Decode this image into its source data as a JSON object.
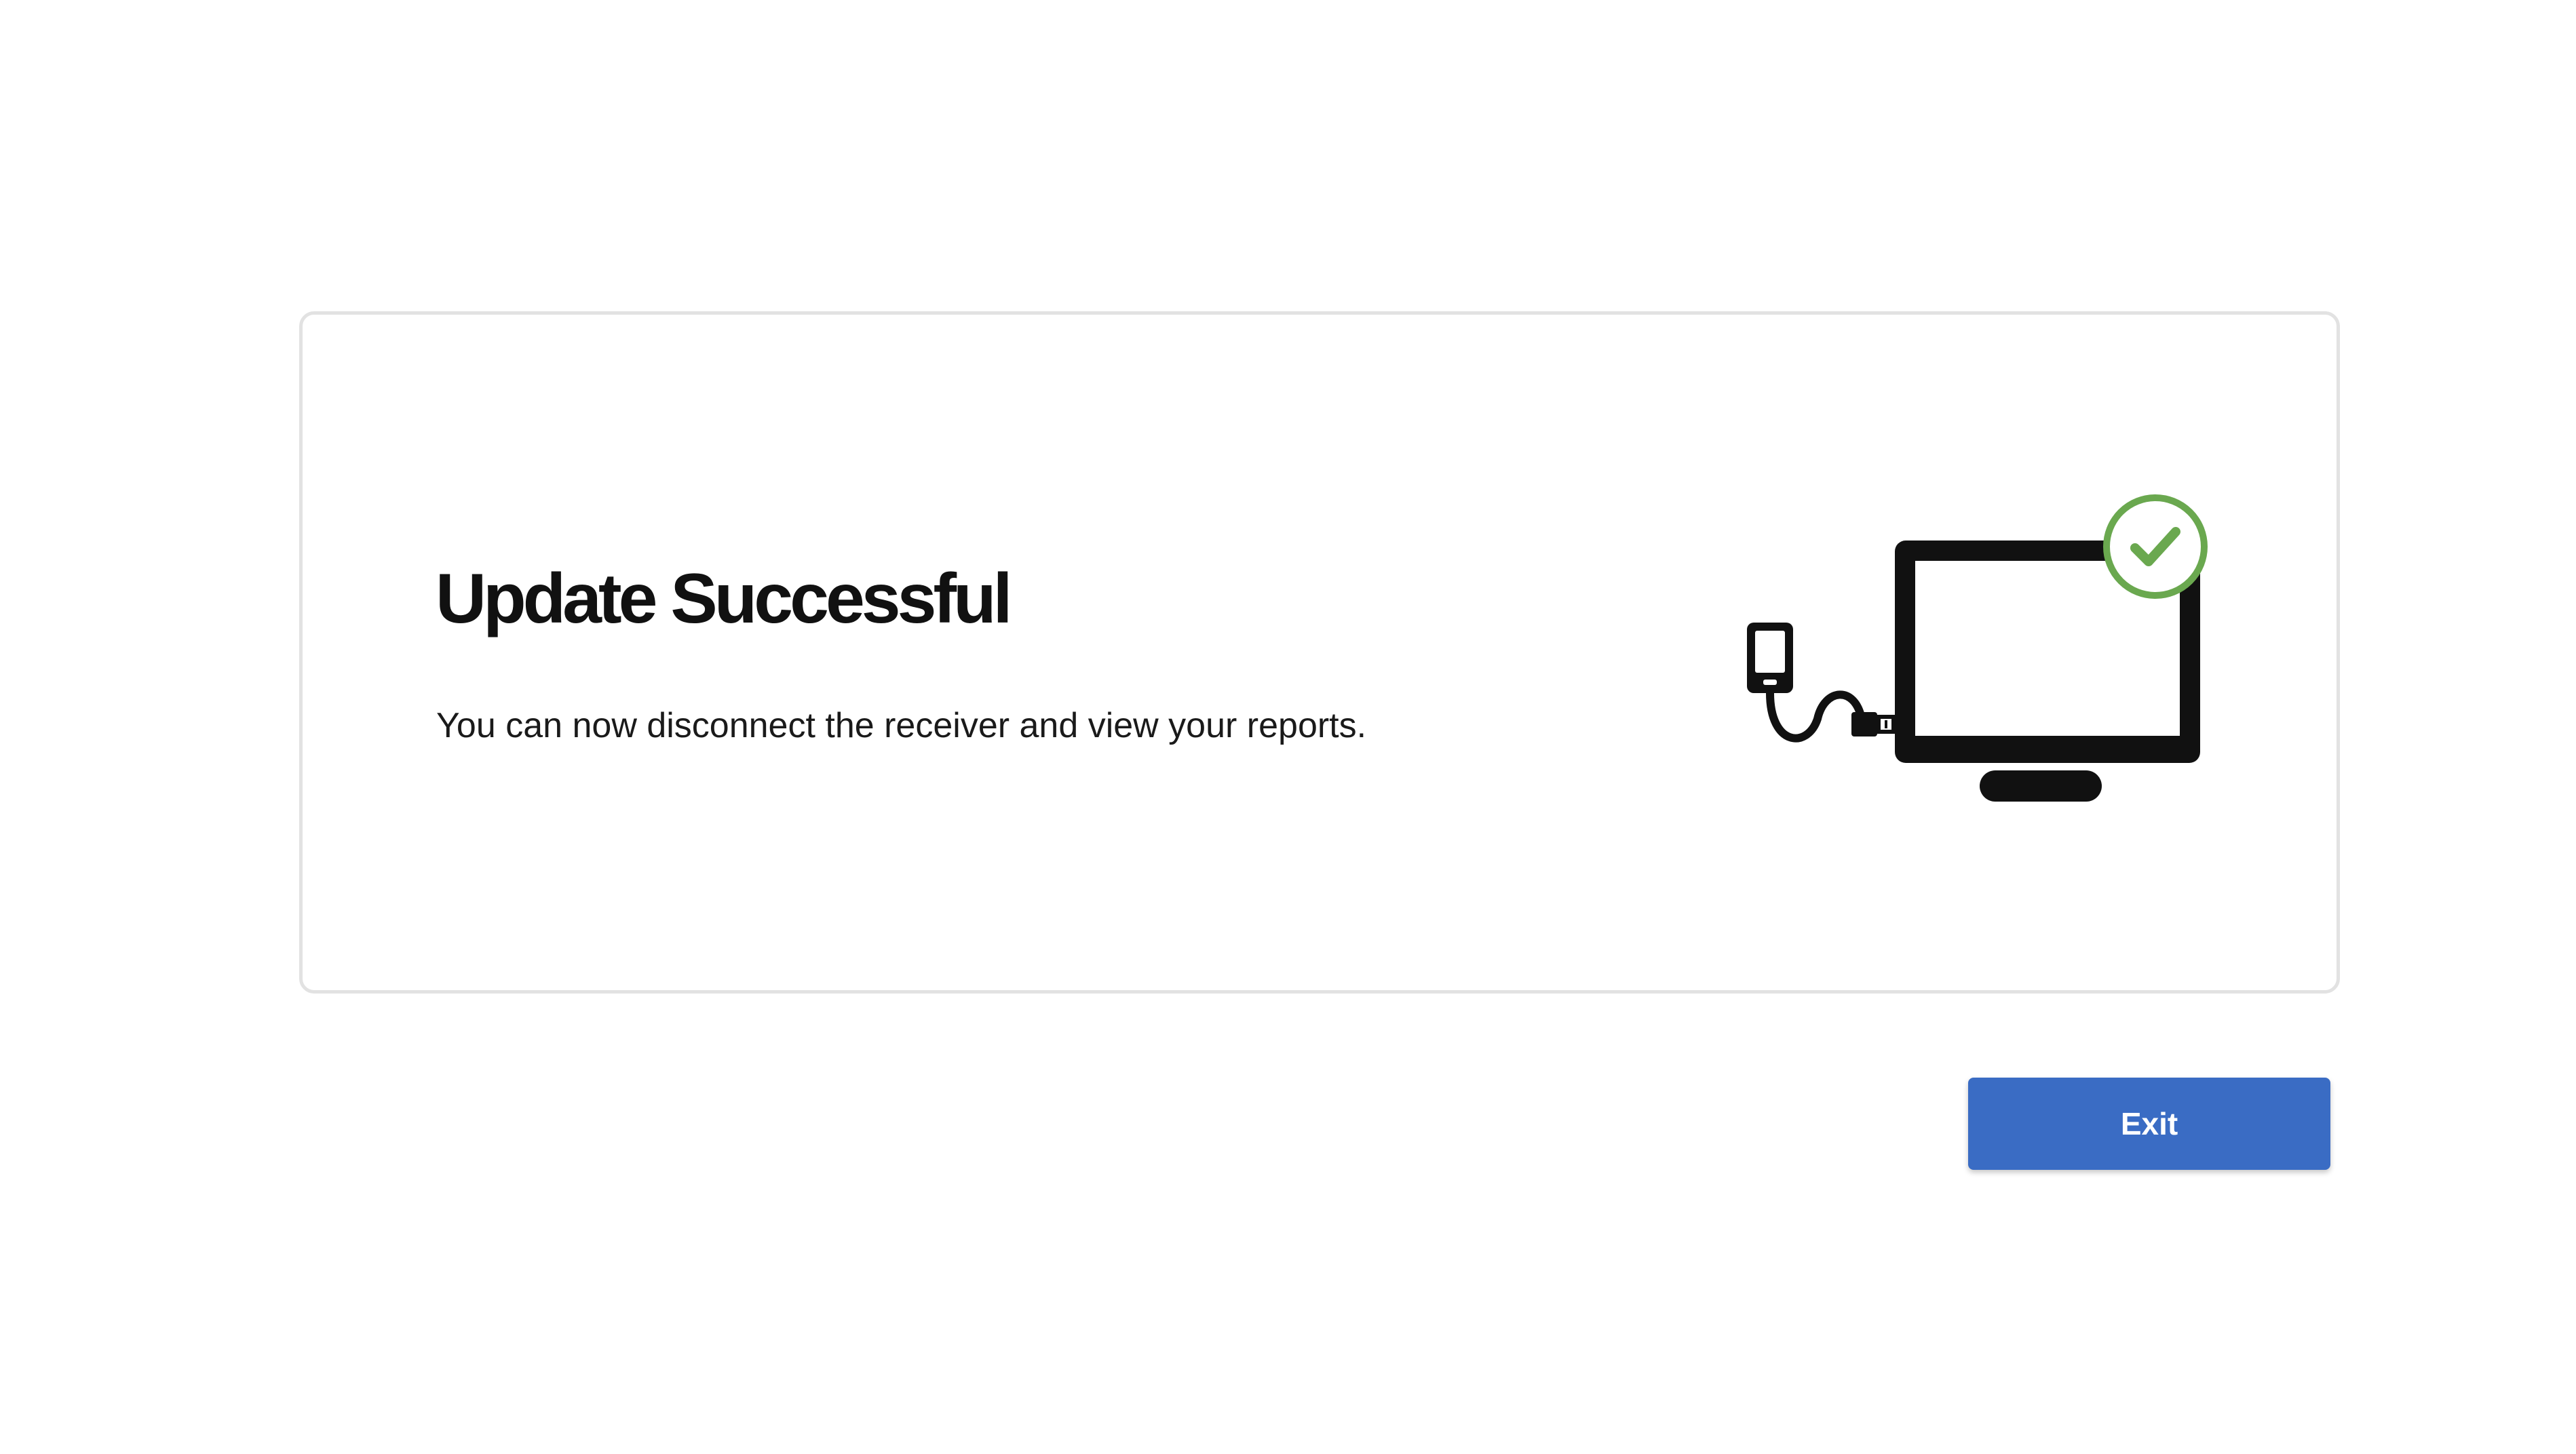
{
  "dialog": {
    "title": "Update Successful",
    "message": "You can now disconnect the receiver and view your reports.",
    "illustration": {
      "icons": [
        "receiver-icon",
        "usb-cable-icon",
        "computer-monitor-icon",
        "success-checkmark-icon"
      ],
      "success_color": "#6aa84f",
      "icon_color": "#111111"
    }
  },
  "actions": {
    "exit_label": "Exit",
    "exit_color": "#3a6cc4"
  }
}
